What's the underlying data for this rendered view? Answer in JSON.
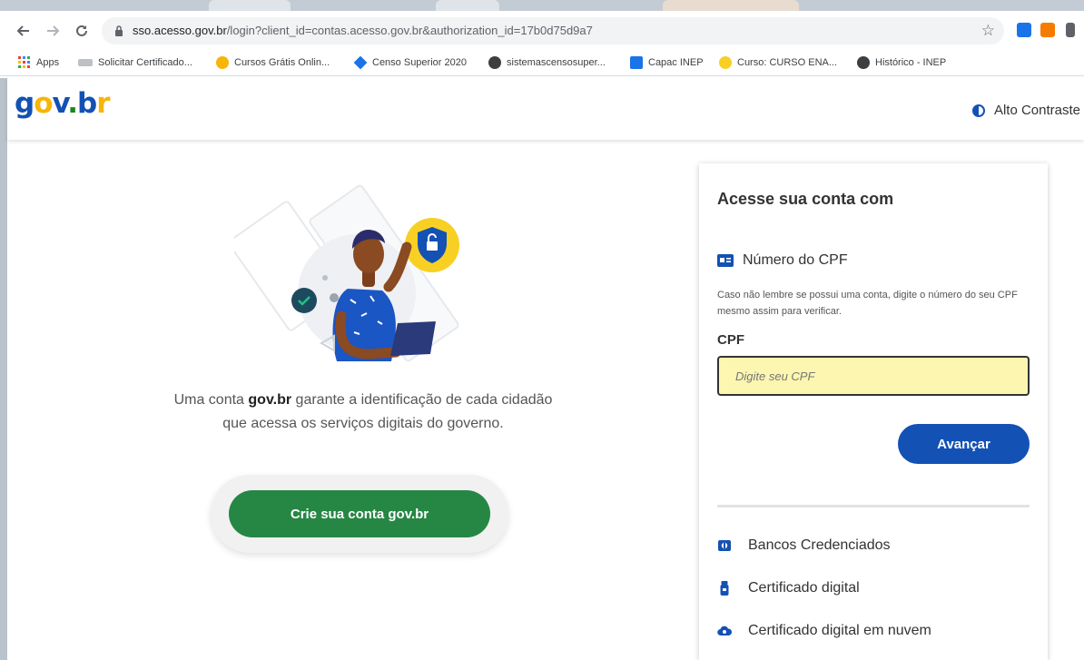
{
  "browser": {
    "url_host": "sso.acesso.gov.br",
    "url_path": "/login?client_id=contas.acesso.gov.br&authorization_id=17b0d75d9a7",
    "back_icon": "arrow-left-icon",
    "forward_icon": "arrow-right-icon",
    "reload_icon": "reload-icon",
    "bookmarks": [
      {
        "label": "Apps",
        "icon": "apps-grid-icon",
        "color": "#ea4335"
      },
      {
        "label": "Solicitar Certificado...",
        "icon": "sap-icon",
        "color": "#9aa0a6"
      },
      {
        "label": "Cursos Grátis Onlin...",
        "icon": "lightbulb-icon",
        "color": "#f8b509"
      },
      {
        "label": "Censo Superior 2020",
        "icon": "diamond-icon",
        "color": "#1a73e8"
      },
      {
        "label": "sistemascensosuper...",
        "icon": "globe-icon",
        "color": "#5f6368"
      },
      {
        "label": "Capac INEP",
        "icon": "inep-icon",
        "color": "#1a73e8"
      },
      {
        "label": "Curso: CURSO ENA...",
        "icon": "bulb-icon",
        "color": "#f8d024"
      },
      {
        "label": "Histórico - INEP",
        "icon": "globe-icon",
        "color": "#5f6368"
      }
    ]
  },
  "header": {
    "logo": {
      "g": "g",
      "o": "o",
      "v": "v",
      "dot": ".",
      "b": "b",
      "r": "r"
    },
    "contrast_label": "Alto Contraste"
  },
  "intro": {
    "text_before": "Uma conta ",
    "bold": "gov.br",
    "text_after": " garante a identificação de cada cidadão que acessa os serviços digitais do governo."
  },
  "create_button": "Crie sua conta gov.br",
  "login": {
    "title": "Acesse sua conta com",
    "cpf_option": "Número do CPF",
    "hint": "Caso não lembre se possui uma conta, digite o número do seu CPF mesmo assim para verificar.",
    "cpf_label": "CPF",
    "cpf_placeholder": "Digite seu CPF",
    "next_button": "Avançar",
    "alternatives": [
      {
        "label": "Bancos Credenciados",
        "icon": "bank-icon"
      },
      {
        "label": "Certificado digital",
        "icon": "usb-token-icon"
      },
      {
        "label": "Certificado digital em nuvem",
        "icon": "cloud-certificate-icon"
      }
    ]
  },
  "colors": {
    "primary_blue": "#1351b4",
    "green": "#268744",
    "input_highlight": "#fcf6b0"
  }
}
